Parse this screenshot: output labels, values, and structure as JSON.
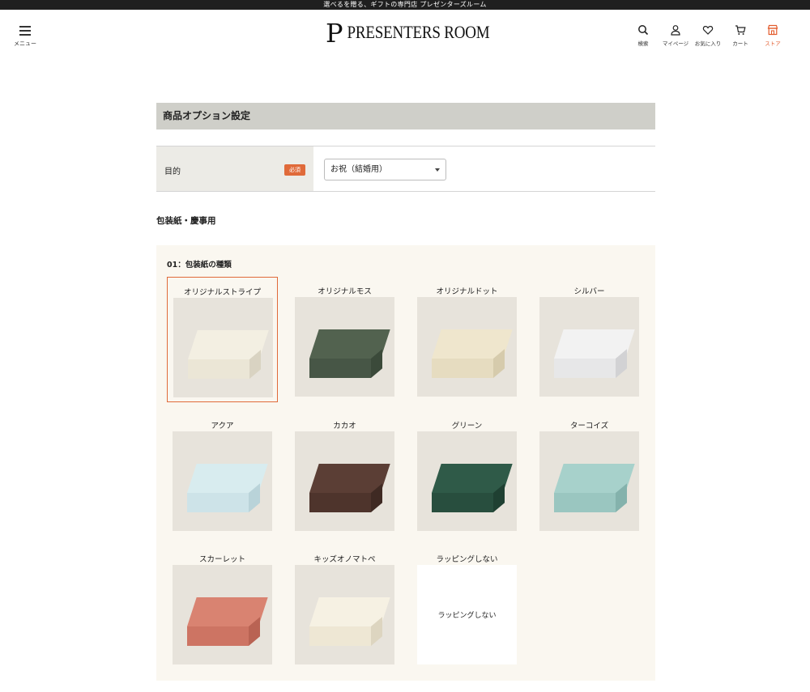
{
  "topbar": {
    "text": "選べるを贈る、ギフトの専門店 プレゼンターズルーム"
  },
  "header": {
    "menu_label": "メニュー",
    "logo_mark": "P",
    "logo_text": "PRESENTERS ROOM",
    "icons": [
      {
        "icon": "search-icon",
        "label": "検索"
      },
      {
        "icon": "user-icon",
        "label": "マイページ"
      },
      {
        "icon": "heart-icon",
        "label": "お気に入り"
      },
      {
        "icon": "cart-icon",
        "label": "カート"
      },
      {
        "icon": "store-icon",
        "label": "ストア"
      }
    ]
  },
  "main": {
    "title": "商品オプション設定",
    "purpose": {
      "label": "目的",
      "required": "必須",
      "selected": "お祝（結婚用）"
    },
    "subhead": "包装紙・慶事用",
    "wrapping": {
      "label": "01：包装紙の種類",
      "options": [
        {
          "name": "オリジナルストライプ",
          "selected": true,
          "top": "#f3efe2",
          "front": "#ebe6d6",
          "side": "#d9d3c2"
        },
        {
          "name": "オリジナルモス",
          "selected": false,
          "top": "#52624f",
          "front": "#475646",
          "side": "#3b4a3a"
        },
        {
          "name": "オリジナルドット",
          "selected": false,
          "top": "#efe6cd",
          "front": "#e6dcc0",
          "side": "#d6cbac"
        },
        {
          "name": "シルバー",
          "selected": false,
          "top": "#f2f2f2",
          "front": "#e7e7e8",
          "side": "#d2d2d4"
        },
        {
          "name": "アクア",
          "selected": false,
          "top": "#d8ecef",
          "front": "#cde3e8",
          "side": "#b9d3d9"
        },
        {
          "name": "カカオ",
          "selected": false,
          "top": "#5b3e35",
          "front": "#4e342c",
          "side": "#3f2a23"
        },
        {
          "name": "グリーン",
          "selected": false,
          "top": "#2f5a48",
          "front": "#284e3e",
          "side": "#1f4032"
        },
        {
          "name": "ターコイズ",
          "selected": false,
          "top": "#a7d1cb",
          "front": "#9ac6c0",
          "side": "#84b2ac"
        },
        {
          "name": "スカーレット",
          "selected": false,
          "top": "#d98371",
          "front": "#cd7463",
          "side": "#b96353"
        },
        {
          "name": "キッズオノマトペ",
          "selected": false,
          "top": "#f6f1e3",
          "front": "#eee7d4",
          "side": "#ddd5c0"
        },
        {
          "name": "ラッピングしない",
          "selected": false,
          "none_text": "ラッピングしない"
        }
      ]
    }
  }
}
